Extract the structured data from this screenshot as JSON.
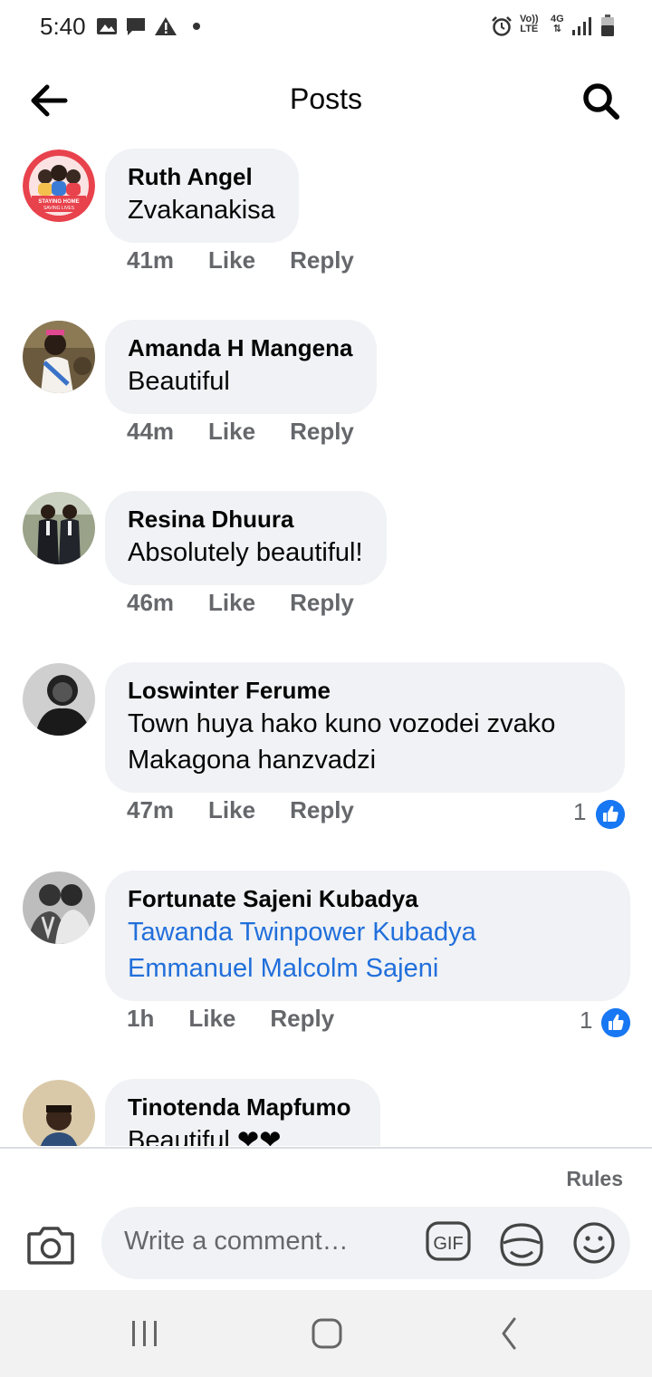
{
  "status_bar": {
    "time": "5:40",
    "left_icons": [
      "image-icon",
      "message-icon",
      "warning-icon",
      "dot-icon"
    ],
    "right_icons": [
      "alarm-icon",
      "volte-icon",
      "4g-icon",
      "signal-icon",
      "battery-icon"
    ],
    "volte_label_top": "Vo))",
    "volte_label_bottom": "LTE",
    "network_label": "4G"
  },
  "header": {
    "title": "Posts",
    "back_icon": "arrow-left-icon",
    "search_icon": "search-icon"
  },
  "comments": [
    {
      "author": "Ruth Angel",
      "lines": [
        "Zvakanakisa"
      ],
      "time": "41m",
      "like": "Like",
      "reply": "Reply"
    },
    {
      "author": "Amanda H Mangena",
      "lines": [
        "Beautiful"
      ],
      "time": "44m",
      "like": "Like",
      "reply": "Reply"
    },
    {
      "author": "Resina Dhuura",
      "lines": [
        "Absolutely beautiful!"
      ],
      "time": "46m",
      "like": "Like",
      "reply": "Reply"
    },
    {
      "author": "Loswinter Ferume",
      "lines": [
        "Town huya hako kuno vozodei zvako",
        "Makagona hanzvadzi"
      ],
      "time": "47m",
      "like": "Like",
      "reply": "Reply",
      "reactions": "1"
    },
    {
      "author": "Fortunate Sajeni Kubadya",
      "lines": [
        "Tawanda Twinpower Kubadya",
        "Emmanuel Malcolm Sajeni"
      ],
      "time": "1h",
      "like": "Like",
      "reply": "Reply",
      "reactions": "1"
    },
    {
      "author": "Tinotenda Mapfumo",
      "lines": [
        "Beautiful ❤❤"
      ]
    }
  ],
  "avatar_1_badge": "STAYING HOME SAVING LIVES",
  "composer": {
    "rules_label": "Rules",
    "placeholder": "Write a comment…",
    "gif_label": "GIF",
    "camera_icon": "camera-icon",
    "sticker_icon": "sticker-icon",
    "emoji_icon": "smiley-icon"
  },
  "nav_bar": {
    "icons": [
      "recent-apps-icon",
      "home-icon",
      "back-icon"
    ]
  },
  "colors": {
    "bubble": "#f0f2f5",
    "link": "#216fdb",
    "meta": "#65676b",
    "like_badge": "#1877f2"
  }
}
